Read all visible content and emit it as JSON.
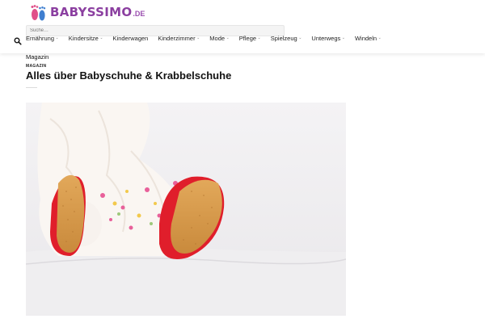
{
  "brand": {
    "name": "BABYSSIMO",
    "tld": ".DE"
  },
  "search": {
    "placeholder": "Suche…"
  },
  "nav": {
    "items": [
      {
        "label": "Ernährung",
        "has_dropdown": true
      },
      {
        "label": "Kindersitze",
        "has_dropdown": true
      },
      {
        "label": "Kinderwagen",
        "has_dropdown": false
      },
      {
        "label": "Kinderzimmer",
        "has_dropdown": true
      },
      {
        "label": "Mode",
        "has_dropdown": true
      },
      {
        "label": "Pflege",
        "has_dropdown": true
      },
      {
        "label": "Spielzeug",
        "has_dropdown": true
      },
      {
        "label": "Unterwegs",
        "has_dropdown": true
      },
      {
        "label": "Windeln",
        "has_dropdown": true
      }
    ],
    "chevron": "⌄"
  },
  "breadcrumb": {
    "category": "Magazin"
  },
  "article": {
    "category_label": "MAGAZIN",
    "title": "Alles über Babyschuhe & Krabbelschuhe",
    "hero_alt_icon": "baby-in-red-shoes-photo"
  },
  "colors": {
    "brand_purple": "#8b3fa0",
    "foot_pink": "#e0508a",
    "foot_blue": "#3f7fd0",
    "shoe_red": "#e01e2b"
  }
}
